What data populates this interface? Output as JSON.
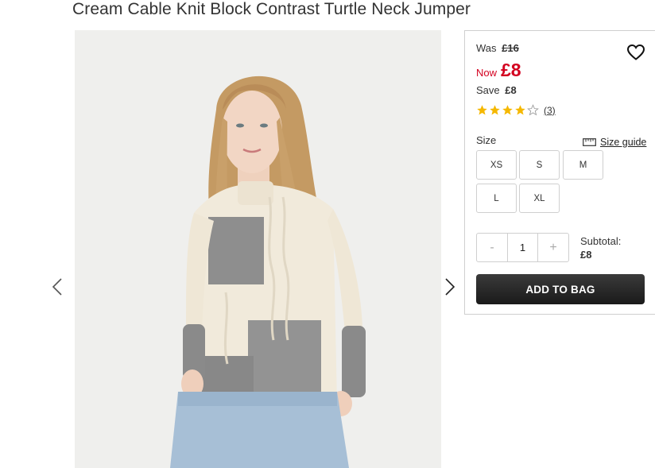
{
  "product": {
    "title": "Cream Cable Knit Block Contrast Turtle Neck Jumper"
  },
  "price": {
    "was_label": "Was",
    "was_value": "£16",
    "now_label": "Now",
    "now_value": "£8",
    "save_label": "Save",
    "save_value": "£8",
    "color_sale": "#d3001f"
  },
  "rating": {
    "stars": 4,
    "max_stars": 5,
    "count": "(3)",
    "star_color": "#f5b800"
  },
  "size": {
    "label": "Size",
    "guide_label": "Size guide",
    "options": [
      "XS",
      "S",
      "M",
      "L",
      "XL"
    ]
  },
  "quantity": {
    "minus": "-",
    "value": "1",
    "plus": "+"
  },
  "subtotal": {
    "label": "Subtotal:",
    "value": "£8"
  },
  "actions": {
    "add_to_bag": "ADD TO BAG"
  },
  "icons": {
    "wishlist": "heart-icon",
    "size_guide": "ruler-icon",
    "prev": "chevron-left-icon",
    "next": "chevron-right-icon"
  }
}
